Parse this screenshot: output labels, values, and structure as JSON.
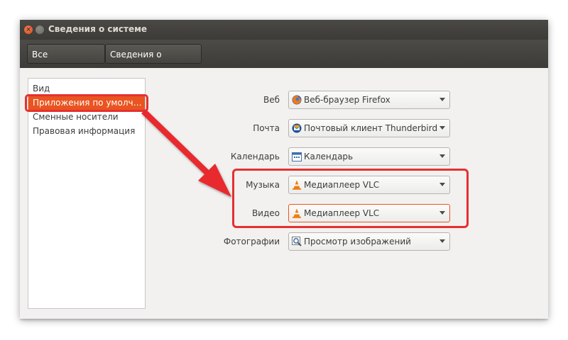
{
  "window": {
    "title": "Сведения о системе",
    "close_glyph": "×"
  },
  "toolbar": {
    "crumbs": [
      {
        "label": "Все параметры"
      },
      {
        "label": "Сведения о системе"
      }
    ]
  },
  "sidebar": {
    "items": [
      {
        "label": "Вид"
      },
      {
        "label": "Приложения по умолч…",
        "selected": true
      },
      {
        "label": "Сменные носители"
      },
      {
        "label": "Правовая информация"
      }
    ]
  },
  "defaults": {
    "rows": [
      {
        "label": "Веб",
        "value": "Веб-браузер Firefox",
        "icon": "firefox-icon"
      },
      {
        "label": "Почта",
        "value": "Почтовый клиент Thunderbird",
        "icon": "thunderbird-icon"
      },
      {
        "label": "Календарь",
        "value": "Календарь",
        "icon": "calendar-icon"
      },
      {
        "label": "Музыка",
        "value": "Медиаплеер VLC",
        "icon": "vlc-icon"
      },
      {
        "label": "Видео",
        "value": "Медиаплеер VLC",
        "icon": "vlc-icon"
      },
      {
        "label": "Фотографии",
        "value": "Просмотр изображений",
        "icon": "image-viewer-icon"
      }
    ]
  },
  "colors": {
    "accent": "#e95420",
    "annotation": "#e53030",
    "titlebar": "#3c3b37"
  }
}
